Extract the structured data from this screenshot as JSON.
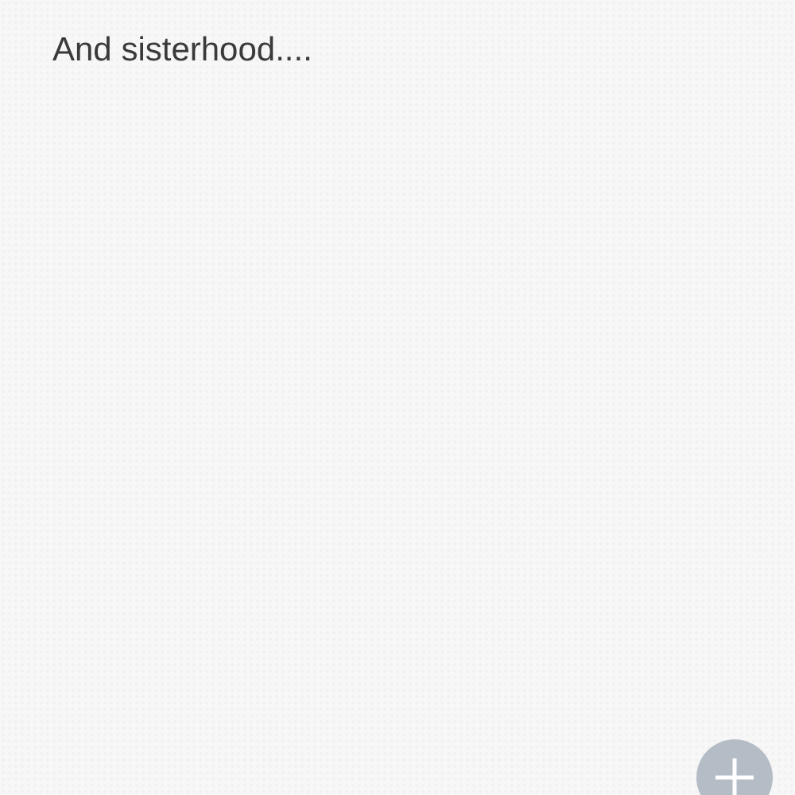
{
  "note": {
    "text": "And sisterhood...."
  }
}
